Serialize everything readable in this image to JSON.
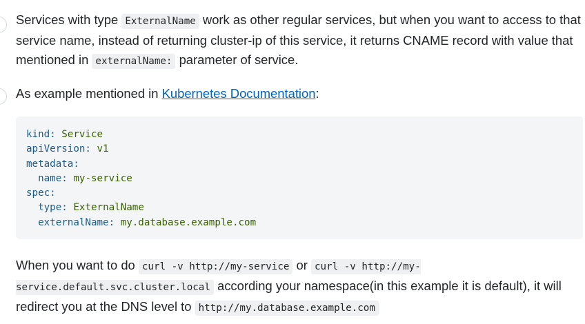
{
  "paragraph1": {
    "text_before": "Services with type ",
    "code_type": "ExternalName",
    "text_middle": " work as other regular services, but when you want to access to that service name, instead of returning cluster-ip of this service, it returns CNAME record with value that mentioned in ",
    "code_param": "externalName:",
    "text_after": " parameter of service."
  },
  "paragraph2": {
    "text_before": "As example mentioned in ",
    "link_label": "Kubernetes Documentation",
    "text_after": ":"
  },
  "code_block": {
    "lines": [
      {
        "key": "kind",
        "value": "Service",
        "indent": 0
      },
      {
        "key": "apiVersion",
        "value": "v1",
        "indent": 0
      },
      {
        "key": "metadata",
        "value": "",
        "indent": 0
      },
      {
        "key": "name",
        "value": "my-service",
        "indent": 1
      },
      {
        "key": "spec",
        "value": "",
        "indent": 0
      },
      {
        "key": "type",
        "value": "ExternalName",
        "indent": 1
      },
      {
        "key": "externalName",
        "value": "my.database.example.com",
        "indent": 1
      }
    ]
  },
  "paragraph3": {
    "text_1": "When you want to do ",
    "code_1": "curl -v http://my-service",
    "text_2": " or ",
    "code_2": "curl -v http://my-service.default.svc.cluster.local",
    "text_3": " according your namespace(in this example it is default), it will redirect you at the DNS level to ",
    "code_3": "http://my.database.example.com"
  },
  "colors": {
    "link": "#0063bf",
    "code_key": "#1d5c8a",
    "code_value": "#386100",
    "code_background": "#f4f5f6",
    "inline_code_background": "#eef0f2"
  }
}
